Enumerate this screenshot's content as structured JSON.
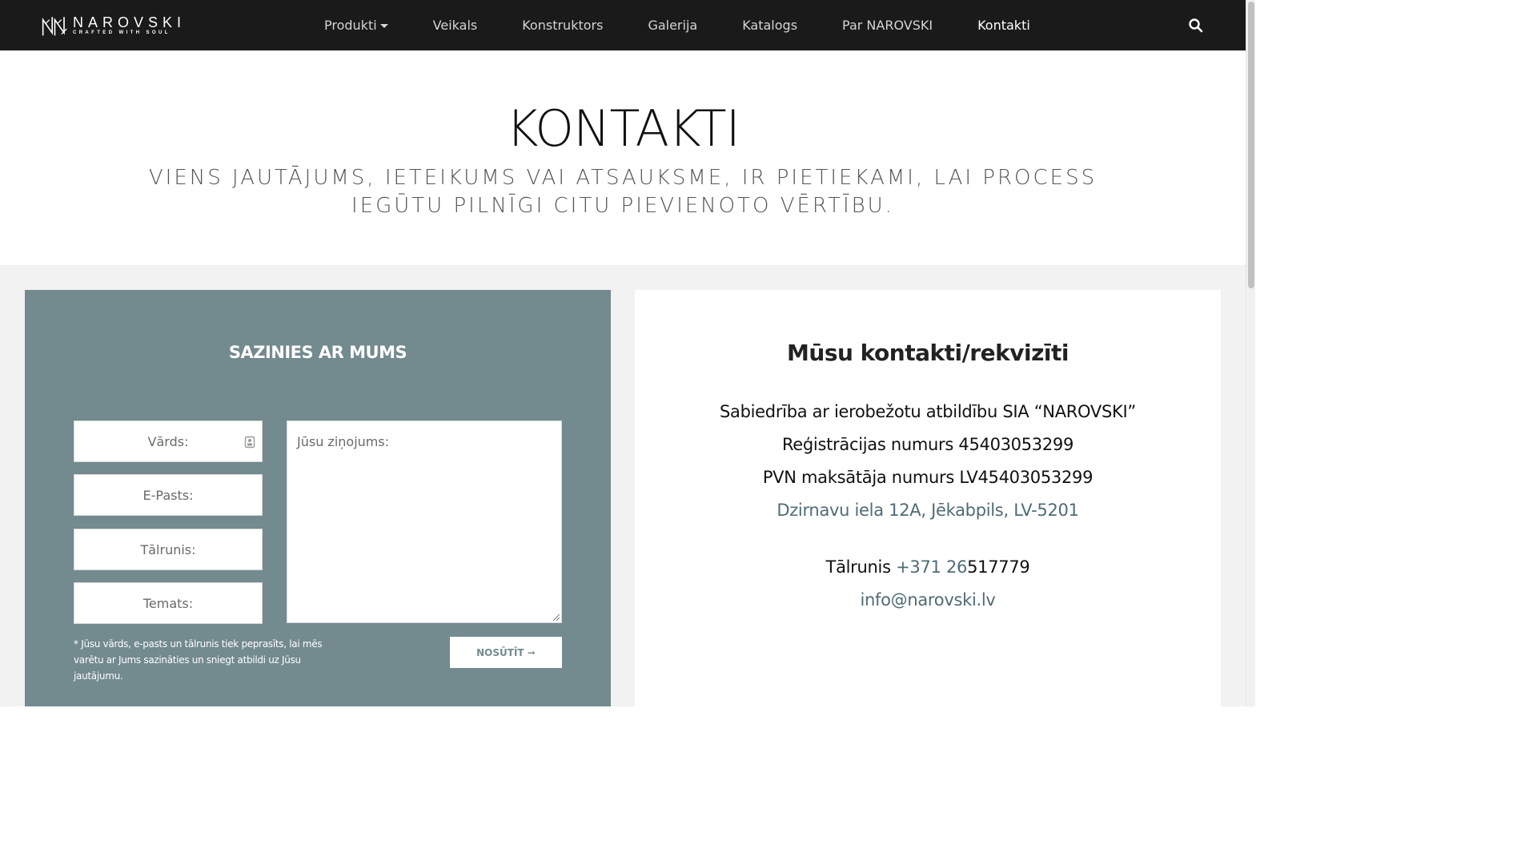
{
  "nav": {
    "logo": {
      "name": "NAROVSKI",
      "tagline": "CRAFTED WITH SOUL"
    },
    "items": [
      {
        "label": "Produkti",
        "has_dropdown": true
      },
      {
        "label": "Veikals"
      },
      {
        "label": "Konstruktors"
      },
      {
        "label": "Galerija"
      },
      {
        "label": "Katalogs"
      },
      {
        "label": "Par NAROVSKI"
      },
      {
        "label": "Kontakti",
        "active": true
      }
    ],
    "search_icon": "search-icon"
  },
  "hero": {
    "title": "KONTAKTI",
    "subtitle": "VIENS JAUTĀJUMS, IETEIKUMS VAI ATSAUKSME, IR PIETIEKAMI, LAI PROCESS IEGŪTU PILNĪGI CITU PIEVIENOTO VĒRTĪBU."
  },
  "form": {
    "title": "SAZINIES AR MUMS",
    "name_placeholder": "Vārds:",
    "email_placeholder": "E-Pasts:",
    "phone_placeholder": "Tālrunis:",
    "subject_placeholder": "Temats:",
    "message_placeholder": "Jūsu ziņojums:",
    "note": "* Jūsu vārds, e-pasts un tālrunis tiek peprasīts, lai mēs varētu ar Jums sazināties un sniegt atbildi uz Jūsu jautājumu.",
    "submit_label": "NOSŪTĪT ➞"
  },
  "contacts": {
    "title": "Mūsu kontakti/rekvizīti",
    "company": "Sabiedrība ar ierobežotu atbildību SIA “NAROVSKI”",
    "reg_number": "Reģistrācijas numurs 45403053299",
    "vat_number": "PVN maksātāja numurs LV45403053299",
    "address": "Dzirnavu iela 12A, Jēkabpils, LV-5201",
    "phone_label": "Tālrunis",
    "phone_link_part": "+371 26",
    "phone_rest": "517779",
    "email": "info@narovski.lv"
  },
  "colors": {
    "nav_bg": "#1a1a1a",
    "form_panel_bg": "#738a8f",
    "link": "#4f6b76",
    "page_bg": "#f2f2f2"
  }
}
